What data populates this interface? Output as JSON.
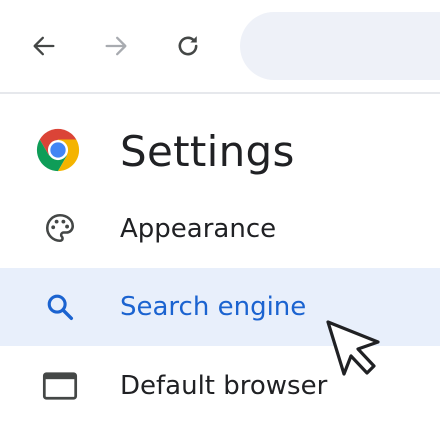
{
  "toolbar": {
    "back_icon": "arrow-left-icon",
    "forward_icon": "arrow-right-icon",
    "reload_icon": "reload-icon",
    "forward_enabled": false,
    "omnibox_value": ""
  },
  "header": {
    "logo": "chrome-logo",
    "title": "Settings"
  },
  "menu": {
    "items": [
      {
        "label": "Appearance",
        "icon": "palette-icon",
        "selected": false
      },
      {
        "label": "Search engine",
        "icon": "search-icon",
        "selected": true
      },
      {
        "label": "Default browser",
        "icon": "browser-window-icon",
        "selected": false
      }
    ]
  },
  "colors": {
    "accent": "#1b63d0",
    "selected_bg": "#e8effb",
    "omnibox_bg": "#eef1f8",
    "text": "#202124",
    "icon": "#444746",
    "disabled_icon": "#a8abb0"
  }
}
